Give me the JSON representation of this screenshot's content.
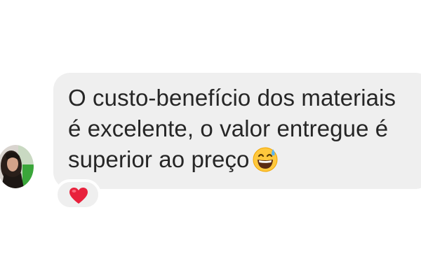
{
  "message": {
    "lines": [
      "O custo-benefício dos materiais",
      "é excelente, o valor entregue é",
      "superior ao preço"
    ],
    "emoji_icon": "grinning-face-with-sweat-emoji"
  },
  "reaction": {
    "icon": "red-heart-icon"
  },
  "avatar": {
    "icon": "user-avatar"
  },
  "colors": {
    "bubble_bg": "#efefef",
    "text": "#262626",
    "heart": "#e8213c"
  }
}
